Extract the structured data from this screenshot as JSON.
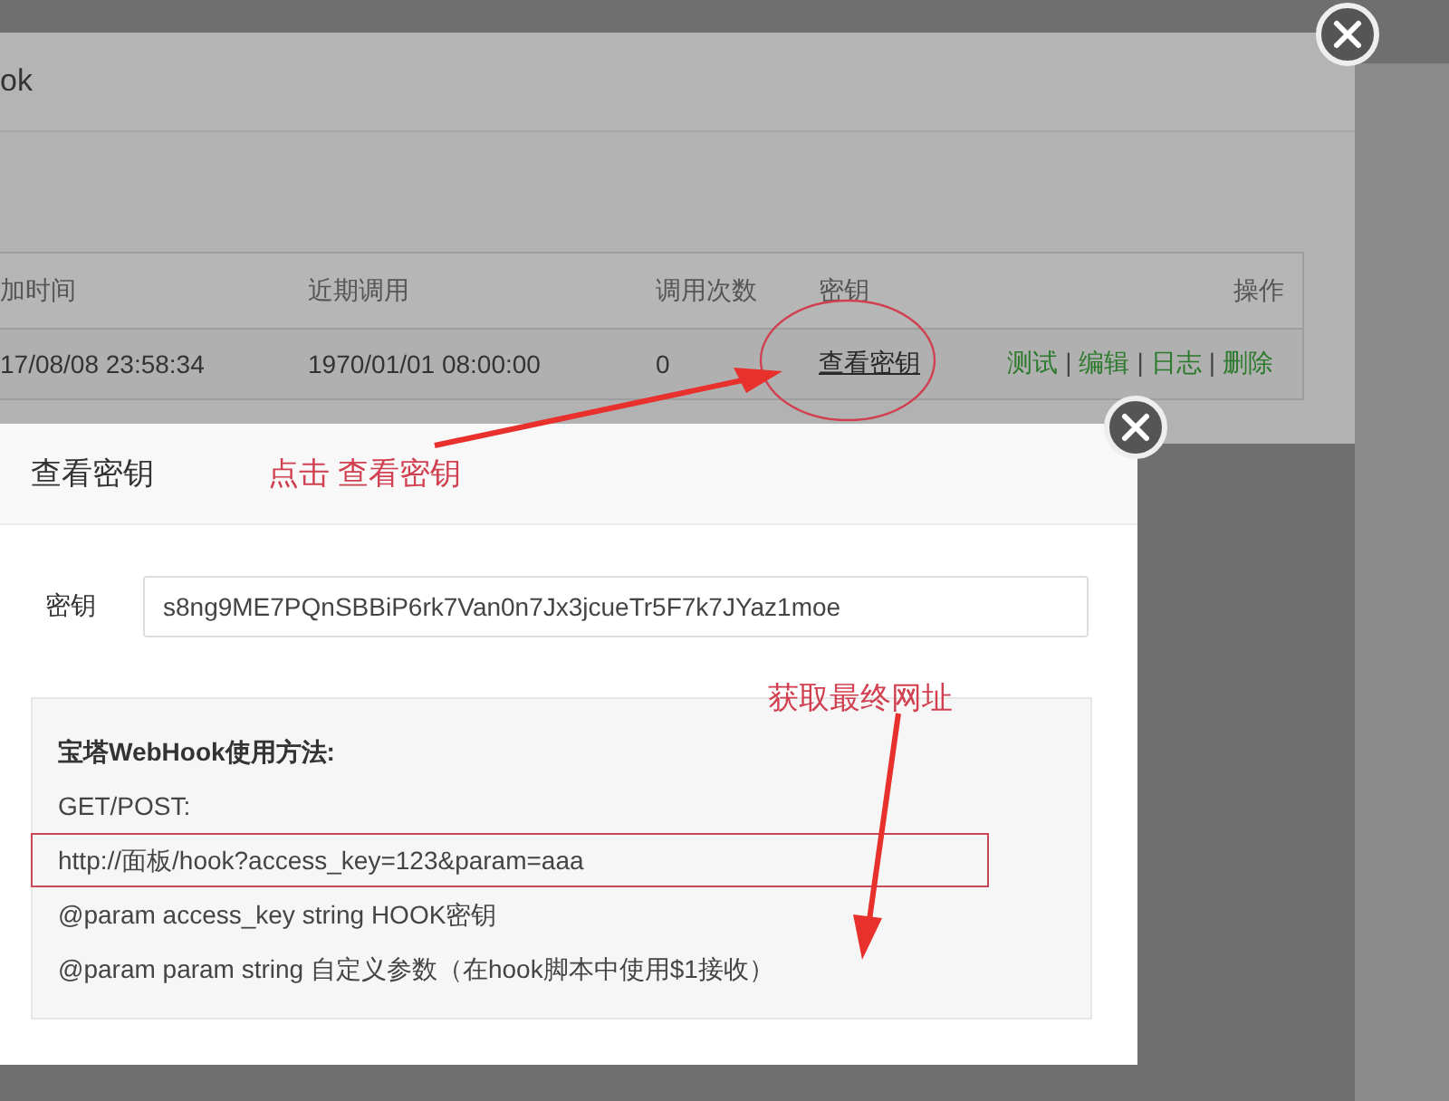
{
  "background_dialog": {
    "title": "ok",
    "table": {
      "columns": [
        "加时间",
        "近期调用",
        "调用次数",
        "密钥",
        "操作"
      ],
      "rows": [
        {
          "cells": [
            "17/08/08 23:58:34",
            "1970/01/01 08:00:00",
            "0"
          ],
          "key_link": {
            "label": "查看密钥",
            "circled": true
          },
          "actions": [
            "测试",
            "编辑",
            "日志",
            "删除"
          ],
          "separator": "|"
        }
      ]
    }
  },
  "dialog": {
    "title": "查看密钥",
    "key_label": "密钥",
    "key_value": "s8ng9ME7PQnSBBiP6rk7Van0n7Jx3jcueTr5F7k7JYaz1moe",
    "usage": {
      "title": "宝塔WebHook使用方法:",
      "lines": [
        {
          "text": "GET/POST:",
          "highlighted": false
        },
        {
          "text": "http://面板/hook?access_key=123&param=aaa",
          "highlighted": true
        },
        {
          "text": "@param access_key string HOOK密钥",
          "highlighted": false
        },
        {
          "text": "@param param string 自定义参数（在hook脚本中使用$1接收）",
          "highlighted": false
        }
      ]
    }
  },
  "annotations": [
    {
      "text": "点击  查看密钥"
    },
    {
      "text": "获取最终网址"
    }
  ]
}
